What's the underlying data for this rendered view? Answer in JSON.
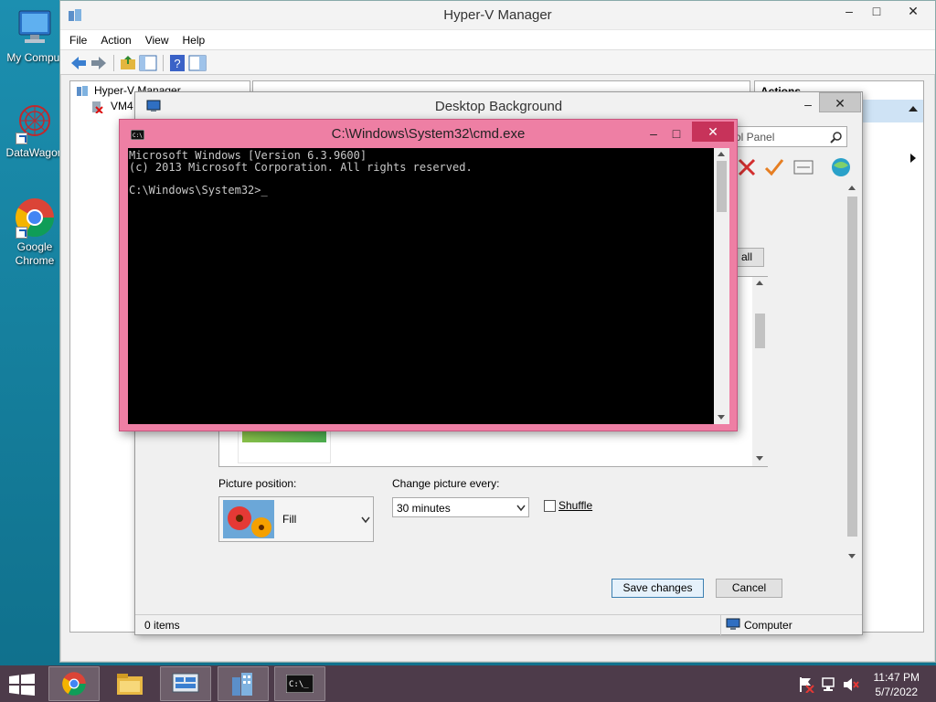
{
  "desktop": {
    "icons": [
      {
        "label": "My Comput"
      },
      {
        "label": "DataWagon"
      },
      {
        "label": "Google\nChrome"
      }
    ]
  },
  "hyperv": {
    "title": "Hyper-V Manager",
    "menu": [
      "File",
      "Action",
      "View",
      "Help"
    ],
    "tree": {
      "root": "Hyper-V Manager",
      "child": "VM4"
    },
    "actions_label": "Actions",
    "status_left": "0 items",
    "status_right": "Computer"
  },
  "desktop_background": {
    "title": "Desktop Background",
    "search_placeholder": "ol Panel",
    "select_all_label": "all",
    "picture_position_label": "Picture position:",
    "picture_position_value": "Fill",
    "change_every_label": "Change picture every:",
    "change_every_value": "30 minutes",
    "shuffle_label": "Shuffle",
    "save_label": "Save changes",
    "cancel_label": "Cancel"
  },
  "cmd": {
    "title": "C:\\Windows\\System32\\cmd.exe",
    "lines": [
      "Microsoft Windows [Version 6.3.9600]",
      "(c) 2013 Microsoft Corporation. All rights reserved.",
      "",
      "C:\\Windows\\System32>_"
    ]
  },
  "taskbar": {
    "time": "11:47 PM",
    "date": "5/7/2022"
  },
  "colors": {
    "desktop": "#1c8fb0",
    "cmd_frame": "#ee7fa4",
    "taskbar": "#4d3b4a",
    "accent": "#1a5fb4"
  }
}
